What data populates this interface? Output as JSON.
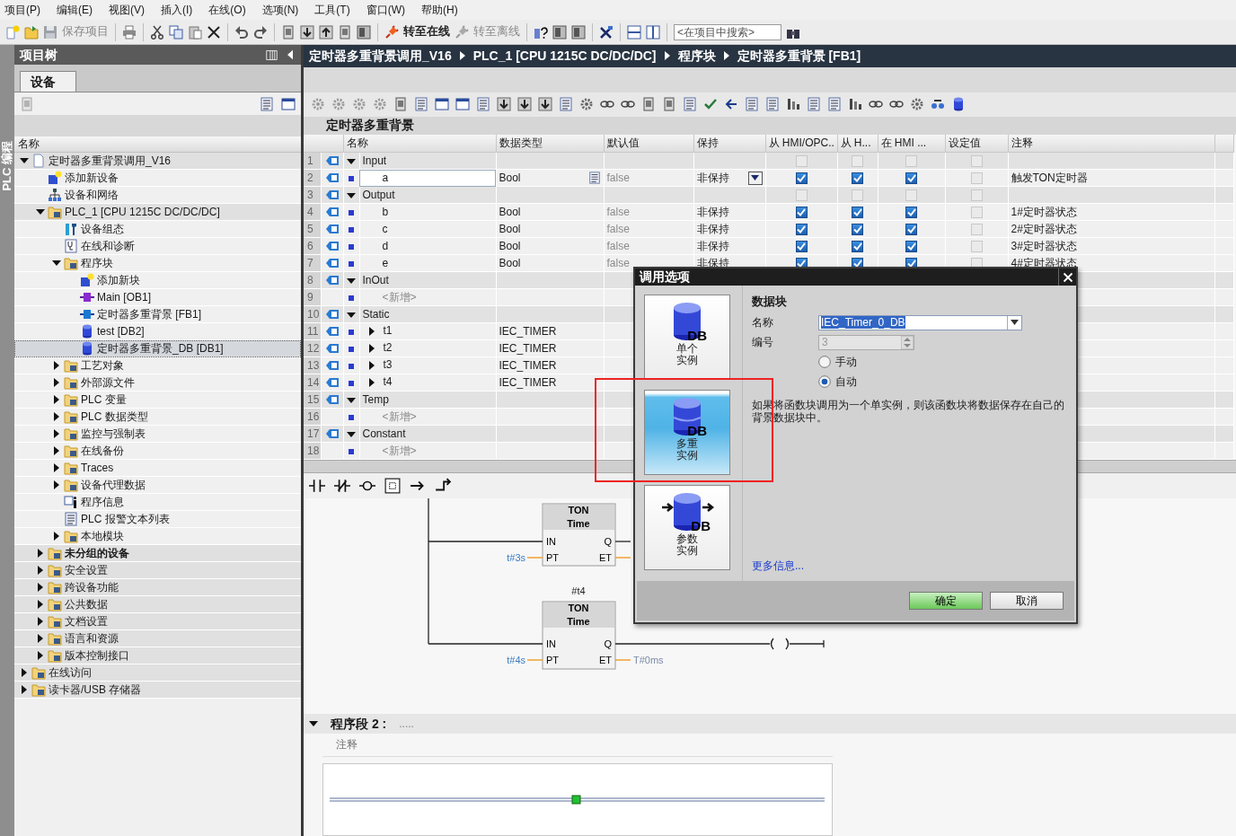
{
  "menu": [
    "项目(P)",
    "编辑(E)",
    "视图(V)",
    "插入(I)",
    "在线(O)",
    "选项(N)",
    "工具(T)",
    "窗口(W)",
    "帮助(H)"
  ],
  "toolbar": {
    "buttons": [
      {
        "label": "保存项目",
        "disabled": true
      },
      {
        "label": "转至在线",
        "disabled": false
      },
      {
        "label": "转至离线",
        "disabled": true
      }
    ],
    "search": {
      "placeholder": "<在项目中搜索>"
    }
  },
  "side_strip": {
    "label": "PLC 编程"
  },
  "project_tree": {
    "title": "项目树",
    "tabs": [
      {
        "label": "设备",
        "selected": true
      }
    ],
    "column": "名称",
    "items": [
      {
        "label": "定时器多重背景调用_V16",
        "expanded": true,
        "selected": false,
        "children": [
          {
            "label": "添加新设备",
            "selected": false
          },
          {
            "label": "设备和网络",
            "selected": false
          },
          {
            "label": "PLC_1 [CPU 1215C DC/DC/DC]",
            "expanded": true,
            "selected": false,
            "children": [
              {
                "label": "设备组态",
                "selected": false
              },
              {
                "label": "在线和诊断",
                "selected": false
              },
              {
                "label": "程序块",
                "expanded": true,
                "selected": false,
                "children": [
                  {
                    "label": "添加新块",
                    "selected": false
                  },
                  {
                    "label": "Main [OB1]",
                    "selected": false
                  },
                  {
                    "label": "定时器多重背景 [FB1]",
                    "selected": false
                  },
                  {
                    "label": "test [DB2]",
                    "selected": false
                  },
                  {
                    "label": "定时器多重背景_DB [DB1]",
                    "selected": true
                  }
                ]
              },
              {
                "label": "工艺对象",
                "expanded": false,
                "selected": false
              },
              {
                "label": "外部源文件",
                "expanded": false,
                "selected": false
              },
              {
                "label": "PLC 变量",
                "expanded": false,
                "selected": false
              },
              {
                "label": "PLC 数据类型",
                "expanded": false,
                "selected": false
              },
              {
                "label": "监控与强制表",
                "expanded": false,
                "selected": false
              },
              {
                "label": "在线备份",
                "expanded": false,
                "selected": false
              },
              {
                "label": "Traces",
                "expanded": false,
                "selected": false
              },
              {
                "label": "设备代理数据",
                "expanded": false,
                "selected": false
              },
              {
                "label": "程序信息",
                "selected": false
              },
              {
                "label": "PLC 报警文本列表",
                "selected": false
              },
              {
                "label": "本地模块",
                "expanded": false,
                "selected": false
              }
            ]
          },
          {
            "label": "未分组的设备",
            "expanded": false,
            "selected": false,
            "bold": true
          },
          {
            "label": "安全设置",
            "expanded": false,
            "selected": false
          },
          {
            "label": "跨设备功能",
            "expanded": false,
            "selected": false
          },
          {
            "label": "公共数据",
            "expanded": false,
            "selected": false
          },
          {
            "label": "文档设置",
            "expanded": false,
            "selected": false
          },
          {
            "label": "语言和资源",
            "expanded": false,
            "selected": false
          },
          {
            "label": "版本控制接口",
            "expanded": false,
            "selected": false
          }
        ]
      },
      {
        "label": "在线访问",
        "expanded": false,
        "selected": false
      },
      {
        "label": "读卡器/USB 存储器",
        "expanded": false,
        "selected": false
      }
    ]
  },
  "breadcrumb": [
    "定时器多重背景调用_V16",
    "PLC_1 [CPU 1215C DC/DC/DC]",
    "程序块",
    "定时器多重背景 [FB1]"
  ],
  "block_interface": {
    "title": "定时器多重背景",
    "columns": [
      "名称",
      "数据类型",
      "默认值",
      "保持",
      "从 HMI/OPC..",
      "从 H...",
      "在 HMI ...",
      "设定值",
      "注释"
    ],
    "rows": [
      {
        "number": "1",
        "kind": "section",
        "name": "Input",
        "expanded": true,
        "selected": false,
        "checks": [
          false,
          false,
          false,
          false
        ]
      },
      {
        "number": "2",
        "kind": "var",
        "name": "a",
        "type": "Bool",
        "default": "false",
        "retain": "非保持",
        "checks": [
          true,
          true,
          true,
          false
        ],
        "comment": "触发TON定时器",
        "selected": true
      },
      {
        "number": "3",
        "kind": "section",
        "name": "Output",
        "expanded": true,
        "selected": false,
        "checks": [
          false,
          false,
          false,
          false
        ]
      },
      {
        "number": "4",
        "kind": "var",
        "name": "b",
        "type": "Bool",
        "default": "false",
        "retain": "非保持",
        "checks": [
          true,
          true,
          true,
          false
        ],
        "comment": "1#定时器状态",
        "selected": false
      },
      {
        "number": "5",
        "kind": "var",
        "name": "c",
        "type": "Bool",
        "default": "false",
        "retain": "非保持",
        "checks": [
          true,
          true,
          true,
          false
        ],
        "comment": "2#定时器状态",
        "selected": false
      },
      {
        "number": "6",
        "kind": "var",
        "name": "d",
        "type": "Bool",
        "default": "false",
        "retain": "非保持",
        "checks": [
          true,
          true,
          true,
          false
        ],
        "comment": "3#定时器状态",
        "selected": false
      },
      {
        "number": "7",
        "kind": "var",
        "name": "e",
        "type": "Bool",
        "default": "false",
        "retain": "非保持",
        "checks": [
          true,
          true,
          true,
          false
        ],
        "comment": "4#定时器状态",
        "selected": false
      },
      {
        "number": "8",
        "kind": "section",
        "name": "InOut",
        "expanded": true,
        "selected": false
      },
      {
        "number": "9",
        "kind": "new",
        "name": "<新增>",
        "selected": false
      },
      {
        "number": "10",
        "kind": "section",
        "name": "Static",
        "expanded": true,
        "selected": false
      },
      {
        "number": "11",
        "kind": "struct",
        "name": "t1",
        "type": "IEC_TIMER",
        "expanded": false,
        "selected": false
      },
      {
        "number": "12",
        "kind": "struct",
        "name": "t2",
        "type": "IEC_TIMER",
        "expanded": false,
        "selected": false
      },
      {
        "number": "13",
        "kind": "struct",
        "name": "t3",
        "type": "IEC_TIMER",
        "expanded": false,
        "selected": false
      },
      {
        "number": "14",
        "kind": "struct",
        "name": "t4",
        "type": "IEC_TIMER",
        "expanded": false,
        "selected": false
      },
      {
        "number": "15",
        "kind": "section",
        "name": "Temp",
        "expanded": true,
        "selected": false
      },
      {
        "number": "16",
        "kind": "new",
        "name": "<新增>",
        "selected": false
      },
      {
        "number": "17",
        "kind": "section",
        "name": "Constant",
        "expanded": true,
        "selected": false
      },
      {
        "number": "18",
        "kind": "new",
        "name": "<新增>",
        "selected": false
      }
    ]
  },
  "ladder": {
    "blocks": [
      {
        "type": "TON",
        "subtype": "Time",
        "pins_in": [
          "IN",
          "PT"
        ],
        "pins_out": [
          "Q",
          "ET"
        ],
        "pt": "t#3s"
      },
      {
        "instance": "#t4",
        "type": "TON",
        "subtype": "Time",
        "pins_in": [
          "IN",
          "PT"
        ],
        "pins_out": [
          "Q",
          "ET"
        ],
        "pt": "t#4s",
        "et": "T#0ms"
      }
    ]
  },
  "network_2": {
    "title": "程序段 2 :",
    "title_suffix": ".....",
    "comment": "注释",
    "expanded": true
  },
  "dialog": {
    "title": "调用选项",
    "options": [
      {
        "label": "单个实例",
        "icon_text": "DB",
        "selected": false
      },
      {
        "label": "多重实例",
        "icon_text": "DB",
        "selected": true
      },
      {
        "label": "参数实例",
        "icon_text": "DB",
        "selected": false
      }
    ],
    "section": "数据块",
    "name_label": "名称",
    "name_value": "IEC_Timer_0_DB",
    "number_label": "编号",
    "number_value": "3",
    "number_disabled": true,
    "radios": [
      {
        "label": "手动",
        "selected": false
      },
      {
        "label": "自动",
        "selected": true
      }
    ],
    "description": "如果将函数块调用为一个单实例，则该函数块将数据保存在自己的背景数据块中。",
    "more_info": "更多信息...",
    "buttons": [
      {
        "label": "确定",
        "kind": "confirm"
      },
      {
        "label": "取消",
        "kind": "cancel"
      }
    ]
  }
}
